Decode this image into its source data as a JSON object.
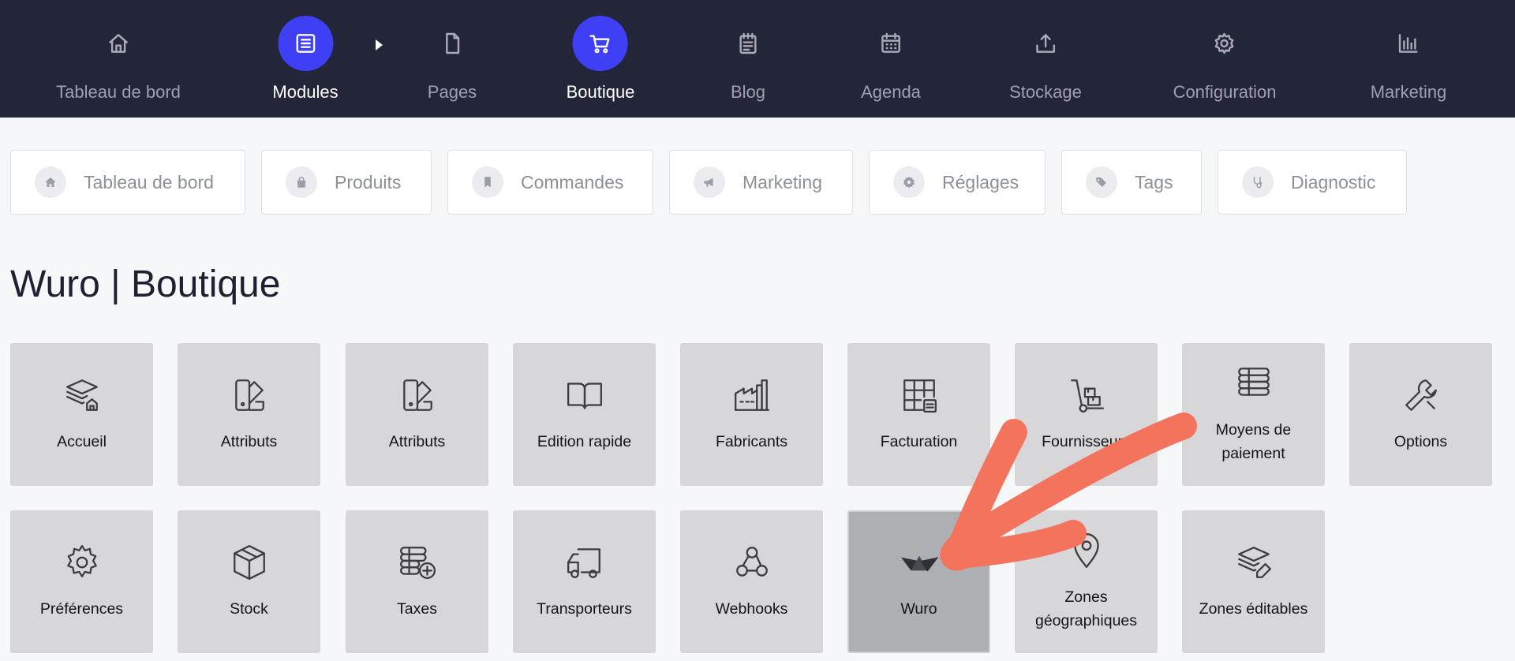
{
  "topnav": {
    "items": [
      {
        "label": "Tableau de bord",
        "icon": "home-icon",
        "active": false
      },
      {
        "label": "Modules",
        "icon": "list-icon",
        "active": true
      },
      {
        "label": "Pages",
        "icon": "file-icon",
        "active": false
      },
      {
        "label": "Boutique",
        "icon": "cart-icon",
        "active": true
      },
      {
        "label": "Blog",
        "icon": "notepad-icon",
        "active": false
      },
      {
        "label": "Agenda",
        "icon": "calendar-icon",
        "active": false
      },
      {
        "label": "Stockage",
        "icon": "upload-icon",
        "active": false
      },
      {
        "label": "Configuration",
        "icon": "gear-icon",
        "active": false
      },
      {
        "label": "Marketing",
        "icon": "bar-chart-icon",
        "active": false
      }
    ]
  },
  "subtabs": [
    {
      "label": "Tableau de bord",
      "icon": "home-icon"
    },
    {
      "label": "Produits",
      "icon": "shopping-bag-icon"
    },
    {
      "label": "Commandes",
      "icon": "bookmark-icon"
    },
    {
      "label": "Marketing",
      "icon": "megaphone-icon"
    },
    {
      "label": "Réglages",
      "icon": "gear-icon"
    },
    {
      "label": "Tags",
      "icon": "tags-icon"
    },
    {
      "label": "Diagnostic",
      "icon": "stethoscope-icon"
    }
  ],
  "page": {
    "title": "Wuro | Boutique"
  },
  "tiles": [
    {
      "label": "Accueil",
      "icon": "layers-home-icon"
    },
    {
      "label": "Attributs",
      "icon": "swatch-book-icon"
    },
    {
      "label": "Attributs",
      "icon": "swatch-book-icon"
    },
    {
      "label": "Edition rapide",
      "icon": "open-book-icon"
    },
    {
      "label": "Fabricants",
      "icon": "factory-icon"
    },
    {
      "label": "Facturation",
      "icon": "grid-receipt-icon"
    },
    {
      "label": "Fournisseurs",
      "icon": "hand-truck-icon"
    },
    {
      "label": "Moyens de paiement",
      "icon": "coin-stack-icon"
    },
    {
      "label": "Options",
      "icon": "wrench-icon"
    },
    {
      "label": "Préférences",
      "icon": "gear-icon"
    },
    {
      "label": "Stock",
      "icon": "box-icon"
    },
    {
      "label": "Taxes",
      "icon": "coins-plus-icon"
    },
    {
      "label": "Transporteurs",
      "icon": "truck-icon"
    },
    {
      "label": "Webhooks",
      "icon": "webhook-icon"
    },
    {
      "label": "Wuro",
      "icon": "wuro-logo-icon",
      "selected": true
    },
    {
      "label": "Zones géographiques",
      "icon": "map-pin-icon"
    },
    {
      "label": "Zones éditables",
      "icon": "layers-edit-icon"
    }
  ],
  "colors": {
    "nav_bg": "#232639",
    "accent": "#3f3ff5",
    "page_bg": "#f6f7f9",
    "tile_bg": "#d7d7d9",
    "tile_selected_bg": "#aeafb2",
    "annotation_arrow": "#f4735c"
  }
}
